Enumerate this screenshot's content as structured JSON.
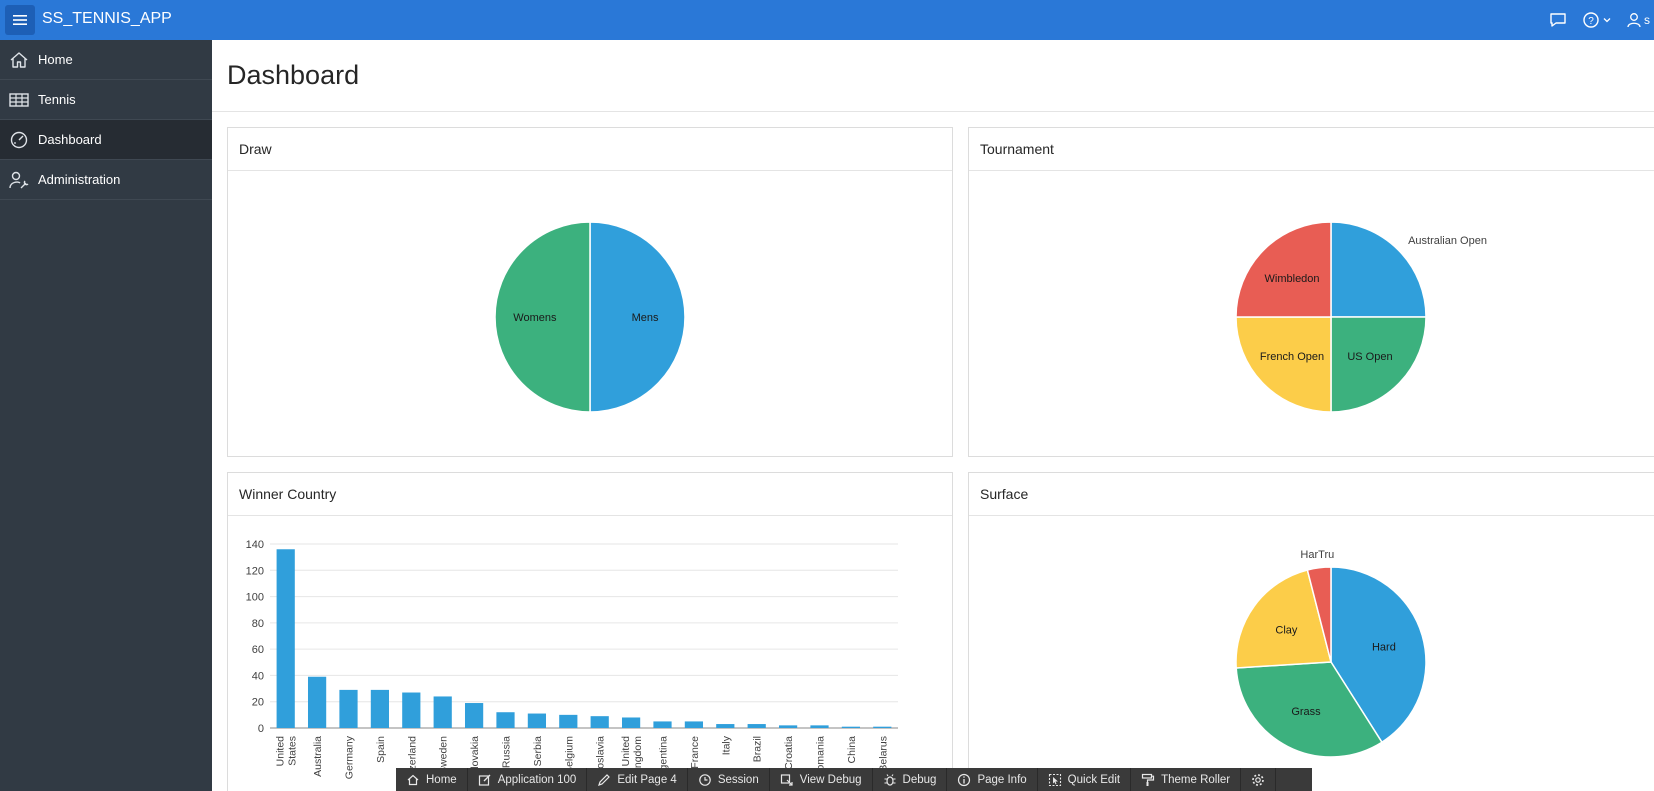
{
  "app": {
    "title": "SS_TENNIS_APP",
    "user_initial": "s",
    "accent_color": "#2a78d7",
    "header_icons": [
      "chat-icon",
      "help-icon",
      "user-icon"
    ]
  },
  "sidebar": {
    "items": [
      {
        "label": "Home",
        "icon": "home-icon",
        "active": false
      },
      {
        "label": "Tennis",
        "icon": "table-icon",
        "active": false
      },
      {
        "label": "Dashboard",
        "icon": "gauge-icon",
        "active": true
      },
      {
        "label": "Administration",
        "icon": "user-wrench-icon",
        "active": false
      }
    ]
  },
  "page": {
    "title": "Dashboard"
  },
  "regions": {
    "draw": {
      "title": "Draw"
    },
    "tournament": {
      "title": "Tournament"
    },
    "winner_country": {
      "title": "Winner Country"
    },
    "surface": {
      "title": "Surface"
    }
  },
  "chart_data": [
    {
      "type": "pie",
      "title": "Draw",
      "categories": [
        "Mens",
        "Womens"
      ],
      "values": [
        50,
        50
      ],
      "colors": [
        "#309fdb",
        "#3cb17e"
      ]
    },
    {
      "type": "pie",
      "title": "Tournament",
      "categories": [
        "Australian Open",
        "US Open",
        "French Open",
        "Wimbledon"
      ],
      "values": [
        25,
        25,
        25,
        25
      ],
      "colors": [
        "#309fdb",
        "#3cb17e",
        "#fccd49",
        "#e85d54"
      ]
    },
    {
      "type": "bar",
      "title": "Winner Country",
      "categories": [
        "United States",
        "Australia",
        "Germany",
        "Spain",
        "Switzerland",
        "Sweden",
        "Czechoslovakia",
        "Russia",
        "Serbia",
        "Belgium",
        "Yugoslavia",
        "United Kingdom",
        "Argentina",
        "France",
        "Italy",
        "Brazil",
        "Croatia",
        "Romania",
        "China",
        "Belarus"
      ],
      "values": [
        136,
        39,
        29,
        29,
        27,
        24,
        19,
        12,
        11,
        10,
        9,
        8,
        5,
        5,
        3,
        3,
        2,
        2,
        1,
        1
      ],
      "color": "#309fdb",
      "yticks": [
        "0",
        "20",
        "40",
        "60",
        "80",
        "100",
        "120",
        "140"
      ],
      "ylim": [
        0,
        140
      ],
      "grid": true
    },
    {
      "type": "pie",
      "title": "Surface",
      "categories": [
        "Hard",
        "Grass",
        "Clay",
        "HarTru"
      ],
      "values": [
        41,
        33,
        22,
        4
      ],
      "colors": [
        "#309fdb",
        "#3cb17e",
        "#fccd49",
        "#e85d54"
      ]
    }
  ],
  "dev_toolbar": {
    "items": [
      {
        "label": "Home",
        "icon": "home-icon"
      },
      {
        "label": "Application 100",
        "icon": "edit-icon"
      },
      {
        "label": "Edit Page 4",
        "icon": "pencil-icon"
      },
      {
        "label": "Session",
        "icon": "clock-icon"
      },
      {
        "label": "View Debug",
        "icon": "view-debug-icon"
      },
      {
        "label": "Debug",
        "icon": "bug-icon"
      },
      {
        "label": "Page Info",
        "icon": "info-icon"
      },
      {
        "label": "Quick Edit",
        "icon": "cursor-icon"
      },
      {
        "label": "Theme Roller",
        "icon": "paint-roller-icon"
      },
      {
        "label": "",
        "icon": "gear-icon"
      }
    ]
  }
}
